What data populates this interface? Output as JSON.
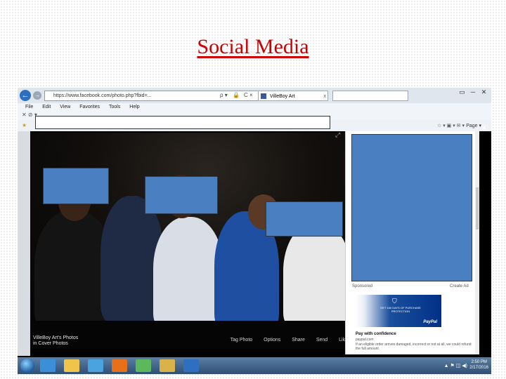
{
  "slide": {
    "title": "Social Media"
  },
  "browser": {
    "address": "https://www.facebook.com/photo.php?fbid=...",
    "tab_title": "VilleBoy Art",
    "tab_close": "x",
    "address_search": "ρ ▾",
    "address_lock": "🔒",
    "address_refresh": "C ×",
    "back_glyph": "←",
    "forward_glyph": "→",
    "window_controls": [
      "▭",
      "─",
      "✕"
    ],
    "menu": [
      "File",
      "Edit",
      "View",
      "Favorites",
      "Tools",
      "Help"
    ],
    "command_left": "✕ ⊘ ▾",
    "command_icons": "☆ ▾ ▣ ▾ ✉ ▾",
    "page_menu": "Page ▾",
    "favorites_star": "★",
    "theater_close": "✕",
    "fullscreen_glyph": "⤢"
  },
  "photo": {
    "album_name": "VilleBoy Art's Photos",
    "album_sub": "in Cover Photos",
    "actions": [
      "Tag Photo",
      "Options",
      "Share",
      "Send",
      "Like"
    ]
  },
  "ad": {
    "sponsored": "Sponsored",
    "create_ad": "Create Ad",
    "banner_shield": "⛉",
    "banner_promo": "GET 180 DAYS OF PURCHASE PROTECTION",
    "banner_logo": "PayPal",
    "title": "Pay with confidence",
    "domain": "paypal.com",
    "text": "If an eligible order arrives damaged, incorrect or not at all, we could refund the full amount."
  },
  "taskbar": {
    "apps": [
      {
        "name": "ie",
        "color": "#3b8fd9"
      },
      {
        "name": "explorer",
        "color": "#f0c34a"
      },
      {
        "name": "media",
        "color": "#4aa3df"
      },
      {
        "name": "firefox",
        "color": "#e8701a"
      },
      {
        "name": "chrome",
        "color": "#5bb85b"
      },
      {
        "name": "apps",
        "color": "#d9b24a"
      },
      {
        "name": "outlook",
        "color": "#2f6fbf"
      }
    ],
    "tray_icons": "▲ ⚑ ◫ ◀)",
    "time": "2:50 PM",
    "date": "2/17/2016"
  }
}
